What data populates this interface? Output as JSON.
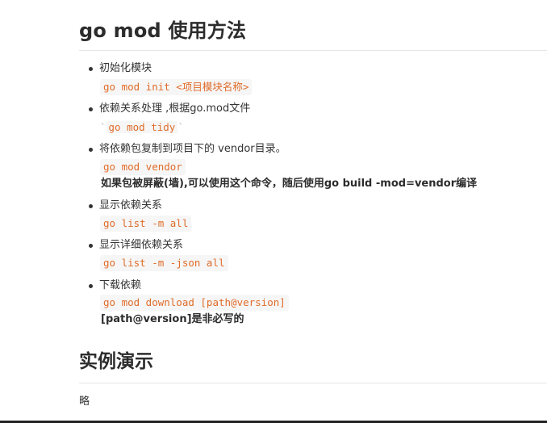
{
  "doc": {
    "title": "go mod 使用方法",
    "items": [
      {
        "label": "初始化模块",
        "code": "go mod init <项目模块名称>"
      },
      {
        "label": "依赖关系处理 ,根据go.mod文件",
        "code": "go mod tidy"
      },
      {
        "label": "将依赖包复制到项目下的 vendor目录。",
        "code": "go mod vendor",
        "note": "如果包被屏蔽(墙),可以使用这个命令，随后使用go build -mod=vendor编译"
      },
      {
        "label": "显示依赖关系",
        "code": "go list -m all"
      },
      {
        "label": "显示详细依赖关系",
        "code": "go list -m -json all"
      },
      {
        "label": "下载依赖",
        "code": "go mod download [path@version]",
        "note": "[path@version]是非必写的"
      }
    ],
    "section2_title": "实例演示",
    "section2_text": "略",
    "tick_left": "`",
    "tick_right": "`"
  }
}
